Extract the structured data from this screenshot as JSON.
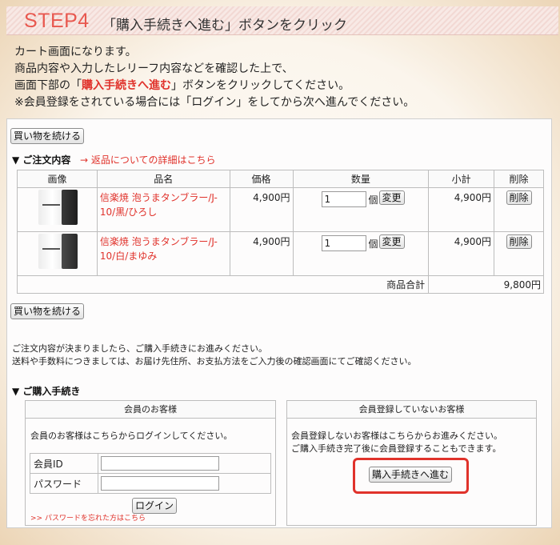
{
  "header": {
    "step": "STEP4",
    "title": "「購入手続きへ進む」ボタンをクリック"
  },
  "intro": {
    "line1": "カート画面になります。",
    "line2": "商品内容や入力したレリーフ内容などを確認した上で、",
    "line3_pre": "画面下部の「",
    "line3_hl": "購入手続きへ進む",
    "line3_post": "」ボタンをクリックしてください。",
    "line4": "※会員登録をされている場合には「ログイン」をしてから次へ進んでください。"
  },
  "cart": {
    "continue_label": "買い物を続ける",
    "order_heading": "▼ ご注文内容",
    "returns_link": "→ 返品についての詳細はこちら",
    "columns": [
      "画像",
      "品名",
      "価格",
      "数量",
      "小計",
      "削除"
    ],
    "items": [
      {
        "name": "信楽焼 泡うまタンブラー/J-10/黒/ひろし",
        "price": "4,900円",
        "qty": "1",
        "unit": "個",
        "change": "変更",
        "subtotal": "4,900円",
        "delete": "削除"
      },
      {
        "name": "信楽焼 泡うまタンブラー/J-10/白/まゆみ",
        "price": "4,900円",
        "qty": "1",
        "unit": "個",
        "change": "変更",
        "subtotal": "4,900円",
        "delete": "削除"
      }
    ],
    "total_label": "商品合計",
    "total_value": "9,800円"
  },
  "notice": {
    "line1": "ご注文内容が決まりましたら、ご購入手続きにお進みください。",
    "line2": "送料や手数料につきましては、お届け先住所、お支払方法をご入力後の確認画面にてご確認ください。"
  },
  "checkout": {
    "heading": "▼ ご購入手続き",
    "member": {
      "title": "会員のお客様",
      "text": "会員のお客様はこちらからログインしてください。",
      "id_label": "会員ID",
      "id_value": "",
      "password_label": "パスワード",
      "password_value": "",
      "login_button": "ログイン",
      "forgot_link": ">>  パスワードを忘れた方はこちら"
    },
    "guest": {
      "title": "会員登録していないお客様",
      "text1": "会員登録しないお客様はこちらからお進みください。",
      "text2": "ご購入手続き完了後に会員登録することもできます。",
      "proceed_button": "購入手続きへ進む"
    }
  }
}
